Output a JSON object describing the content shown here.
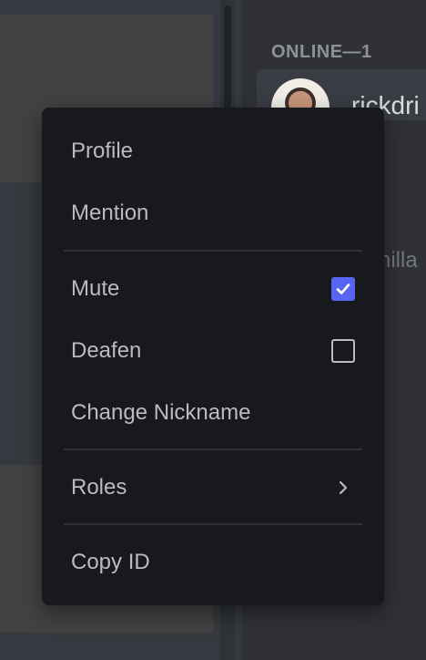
{
  "member_list": {
    "section_header": "ONLINE—1",
    "member_name": "rickdri",
    "member_status": "nilla"
  },
  "context_menu": {
    "items": {
      "profile": "Profile",
      "mention": "Mention",
      "mute": "Mute",
      "deafen": "Deafen",
      "change_nickname": "Change Nickname",
      "roles": "Roles",
      "copy_id": "Copy ID"
    },
    "states": {
      "mute_checked": true,
      "deafen_checked": false
    },
    "icons": {
      "mute": "checkbox-checked-icon",
      "deafen": "checkbox-empty-icon",
      "roles": "chevron-right-icon"
    }
  },
  "colors": {
    "menu_background": "#18191c",
    "checkbox_checked": "#5865f2",
    "menu_text": "#b9bbbe"
  }
}
